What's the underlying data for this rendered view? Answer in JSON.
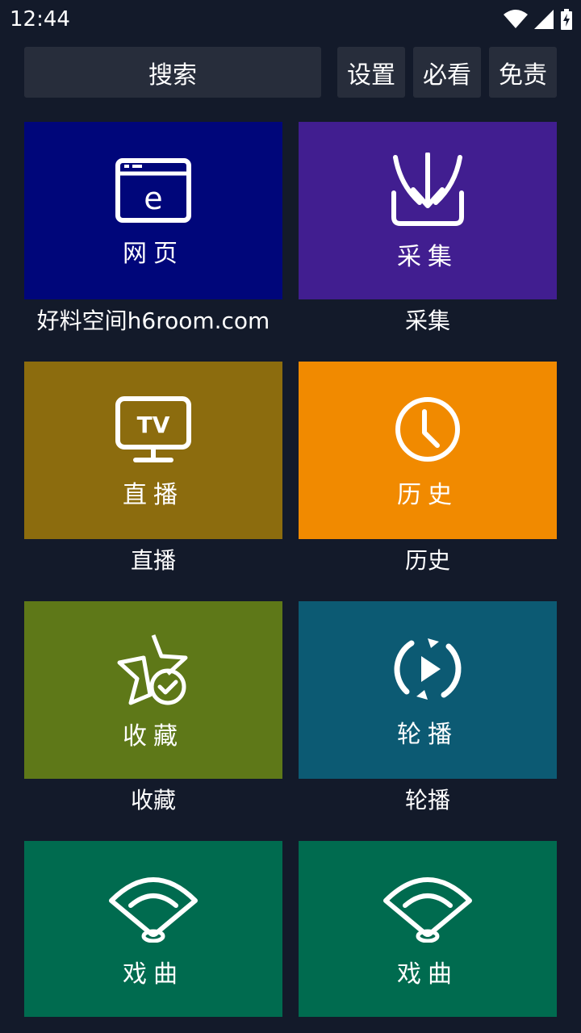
{
  "status": {
    "time": "12:44"
  },
  "topbar": {
    "search_label": "搜索",
    "settings_label": "设置",
    "mustwatch_label": "必看",
    "disclaimer_label": "免责"
  },
  "tiles": [
    {
      "label": "网页",
      "caption": "好料空间h6room.com",
      "color": "#00067a",
      "icon": "browser-icon"
    },
    {
      "label": "采集",
      "caption": "采集",
      "color": "#411e90",
      "icon": "download-collect-icon"
    },
    {
      "label": "直播",
      "caption": "直播",
      "color": "#8c6c0e",
      "icon": "tv-icon"
    },
    {
      "label": "历史",
      "caption": "历史",
      "color": "#f18a00",
      "icon": "clock-icon"
    },
    {
      "label": "收藏",
      "caption": "收藏",
      "color": "#5e7818",
      "icon": "star-check-icon"
    },
    {
      "label": "轮播",
      "caption": "轮播",
      "color": "#0c5a73",
      "icon": "carousel-play-icon"
    },
    {
      "label": "戏曲",
      "caption": "",
      "color": "#006b4f",
      "icon": "fan-icon"
    },
    {
      "label": "戏曲",
      "caption": "",
      "color": "#006b4f",
      "icon": "fan-icon"
    }
  ],
  "icon_tv_text": "TV",
  "icon_browser_text": "e"
}
